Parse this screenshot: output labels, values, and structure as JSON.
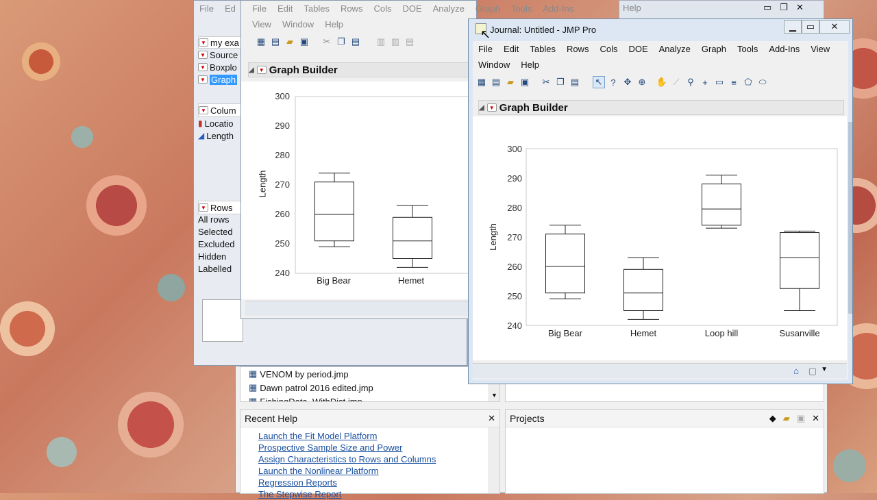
{
  "back_window": {
    "menu": [
      "File",
      "Ed"
    ],
    "help_label": "Help",
    "panels": {
      "items": [
        "my exa",
        "Source",
        "Boxplo",
        "Graph"
      ],
      "columns_title": "Colum",
      "columns": [
        "Locatio",
        "Length"
      ],
      "rows_title": "Rows",
      "row_states": [
        "All rows",
        "Selected",
        "Excluded",
        "Hidden",
        "Labelled"
      ]
    }
  },
  "middle_window": {
    "menu_row1": [
      "File",
      "Edit",
      "Tables",
      "Rows",
      "Cols",
      "DOE",
      "Analyze",
      "Graph",
      "Tools",
      "Add-Ins"
    ],
    "menu_row2": [
      "View",
      "Window",
      "Help"
    ],
    "outline_title": "Graph Builder",
    "y_label": "Length",
    "y_ticks": [
      "300",
      "290",
      "280",
      "270",
      "260",
      "250",
      "240"
    ],
    "categories": [
      "Big Bear",
      "Hemet"
    ]
  },
  "journal_window": {
    "title": "Journal: Untitled - JMP Pro",
    "menu_row1": [
      "File",
      "Edit",
      "Tables",
      "Rows",
      "Cols",
      "DOE",
      "Analyze",
      "Graph",
      "Tools",
      "Add-Ins",
      "View"
    ],
    "menu_row2": [
      "Window",
      "Help"
    ],
    "outline_title": "Graph Builder"
  },
  "chart_data": {
    "type": "box",
    "ylabel": "Length",
    "ylim": [
      240,
      300
    ],
    "y_ticks": [
      300,
      290,
      280,
      270,
      260,
      250,
      240
    ],
    "categories": [
      "Big Bear",
      "Hemet",
      "Loop hill",
      "Susanville"
    ],
    "boxes": [
      {
        "category": "Big Bear",
        "min": 249,
        "q1": 251,
        "median": 260,
        "q3": 271,
        "max": 274
      },
      {
        "category": "Hemet",
        "min": 242,
        "q1": 245,
        "median": 251,
        "q3": 259,
        "max": 263
      },
      {
        "category": "Loop hill",
        "min": 273,
        "q1": 274,
        "median": 279.5,
        "q3": 288,
        "max": 291
      },
      {
        "category": "Susanville",
        "min": 245,
        "q1": 252.5,
        "median": 263,
        "q3": 271.5,
        "max": 272
      }
    ]
  },
  "home_window": {
    "recent_files": [
      "VENOM by period.jmp",
      "Dawn patrol 2016 edited.jmp",
      "FishingData_WithDist.jmp"
    ],
    "recent_help_title": "Recent Help",
    "recent_help_links": [
      "Launch the Fit Model Platform",
      "Prospective Sample Size and Power",
      "Assign Characteristics to Rows and Columns",
      "Launch the Nonlinear Platform",
      "Regression Reports",
      "The Stepwise Report"
    ],
    "projects_title": "Projects"
  },
  "right_window": {
    "help_label": "Help"
  }
}
